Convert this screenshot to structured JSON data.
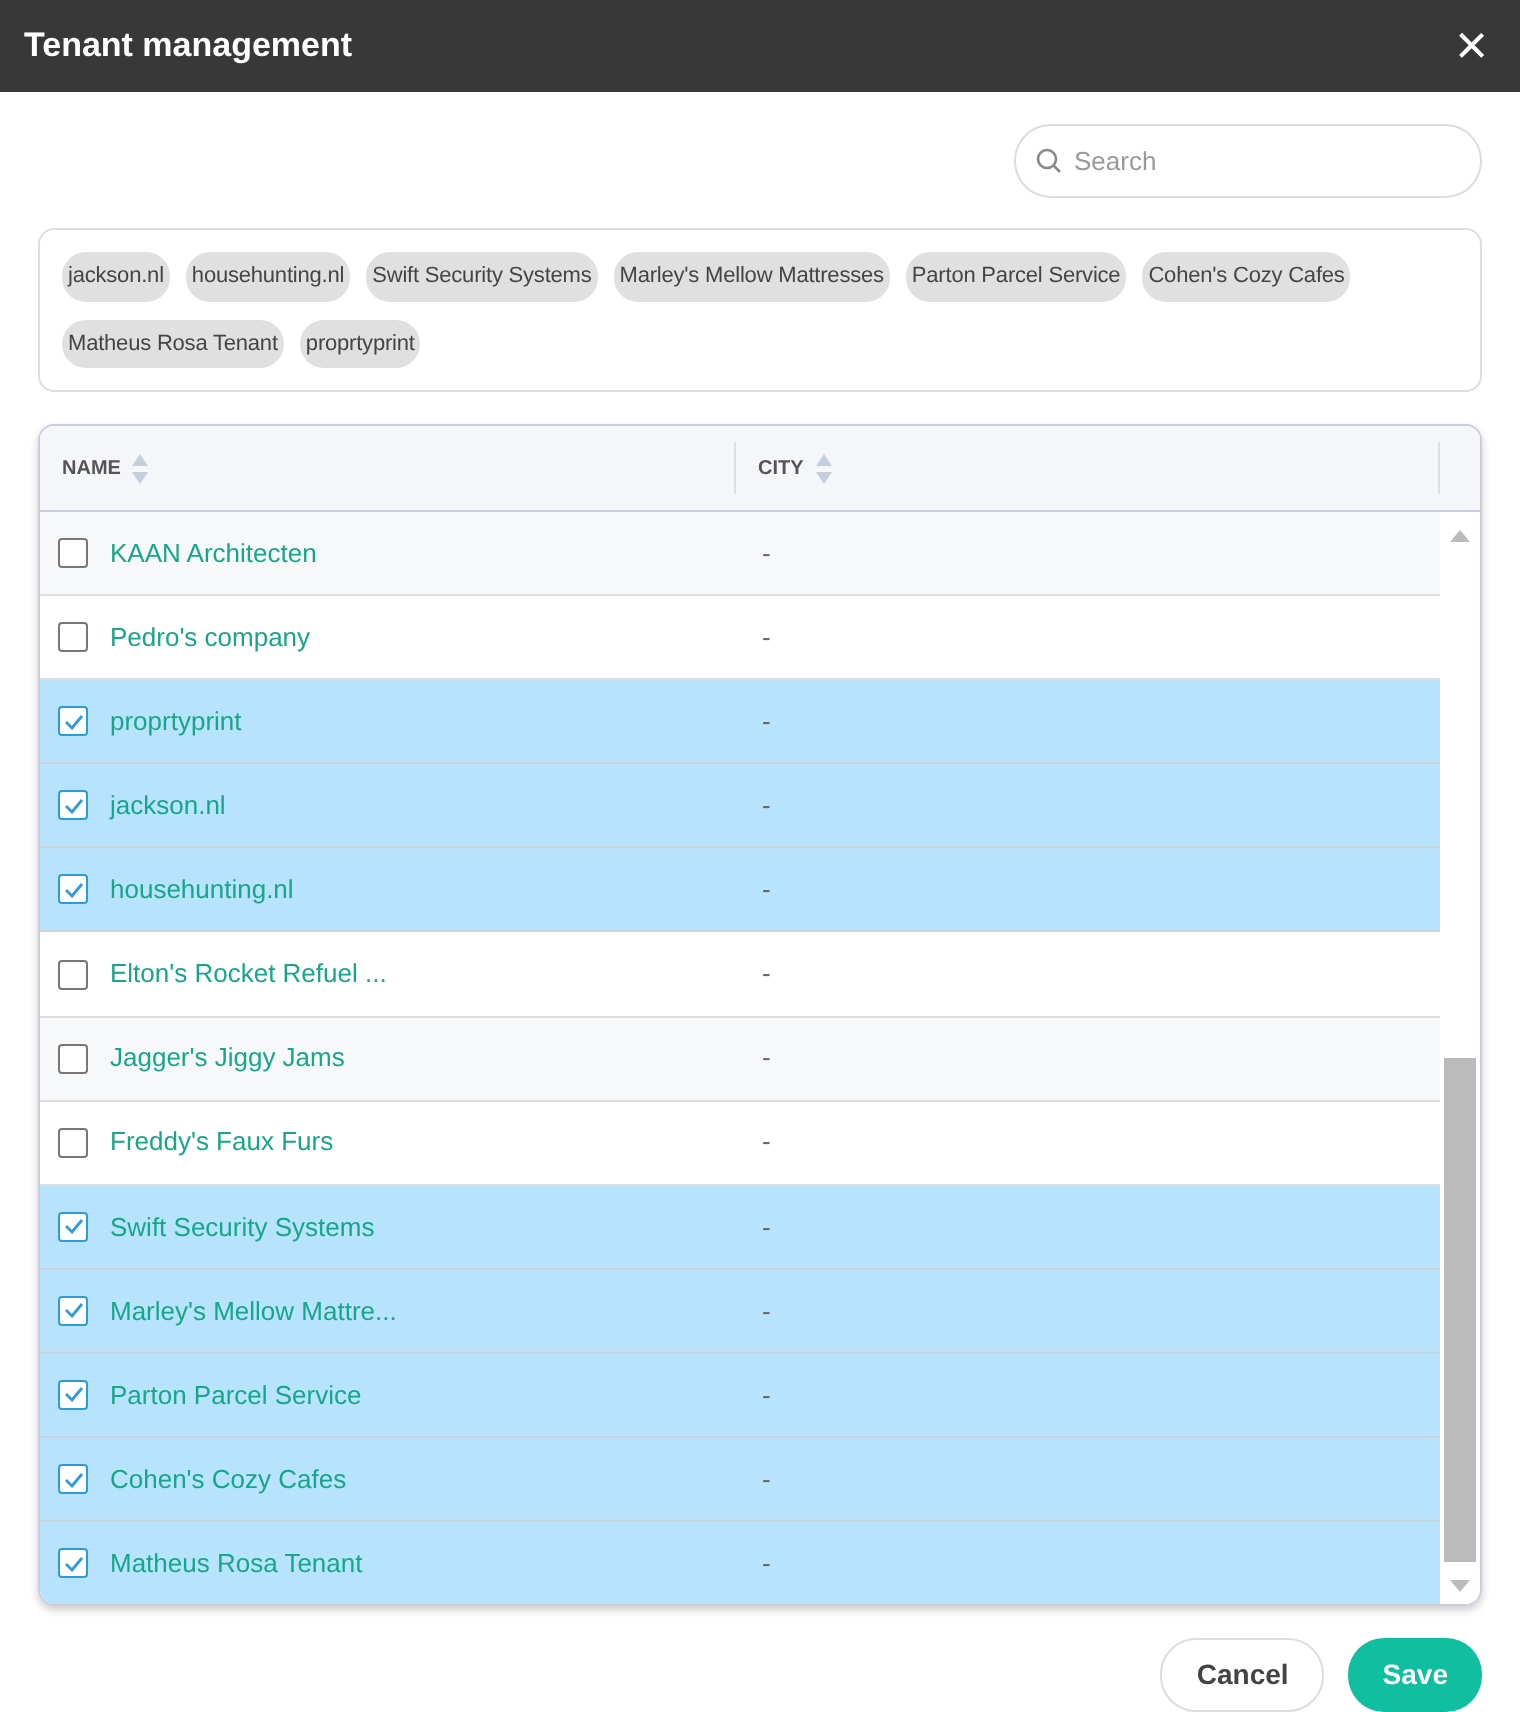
{
  "window": {
    "title": "Tenant management",
    "close": "×"
  },
  "search": {
    "placeholder": "Search"
  },
  "tags": [
    "jackson.nl",
    "househunting.nl",
    "Swift Security Systems",
    "Marley's Mellow Mattresses",
    "Parton Parcel Service",
    "Cohen's Cozy Cafes",
    "Matheus Rosa Tenant",
    "proprtyprint"
  ],
  "table": {
    "columns": [
      "NAME",
      "CITY"
    ],
    "rows": [
      {
        "name": "KAAN Architecten",
        "city": "-",
        "selected": false
      },
      {
        "name": "Pedro's company",
        "city": "-",
        "selected": false
      },
      {
        "name": "proprtyprint",
        "city": "-",
        "selected": true
      },
      {
        "name": "jackson.nl",
        "city": "-",
        "selected": true
      },
      {
        "name": "househunting.nl",
        "city": "-",
        "selected": true
      },
      {
        "name": "Elton's Rocket Refuel ...",
        "city": "-",
        "selected": false
      },
      {
        "name": "Jagger's Jiggy Jams",
        "city": "-",
        "selected": false
      },
      {
        "name": "Freddy's Faux Furs",
        "city": "-",
        "selected": false
      },
      {
        "name": "Swift Security Systems",
        "city": "-",
        "selected": true
      },
      {
        "name": "Marley's Mellow Mattre...",
        "city": "-",
        "selected": true
      },
      {
        "name": "Parton Parcel Service",
        "city": "-",
        "selected": true
      },
      {
        "name": "Cohen's Cozy Cafes",
        "city": "-",
        "selected": true
      },
      {
        "name": "Matheus Rosa Tenant",
        "city": "-",
        "selected": true
      }
    ]
  },
  "buttons": [
    {
      "label": "Cancel",
      "kind": "secondary"
    },
    {
      "label": "Save",
      "kind": "primary"
    }
  ]
}
